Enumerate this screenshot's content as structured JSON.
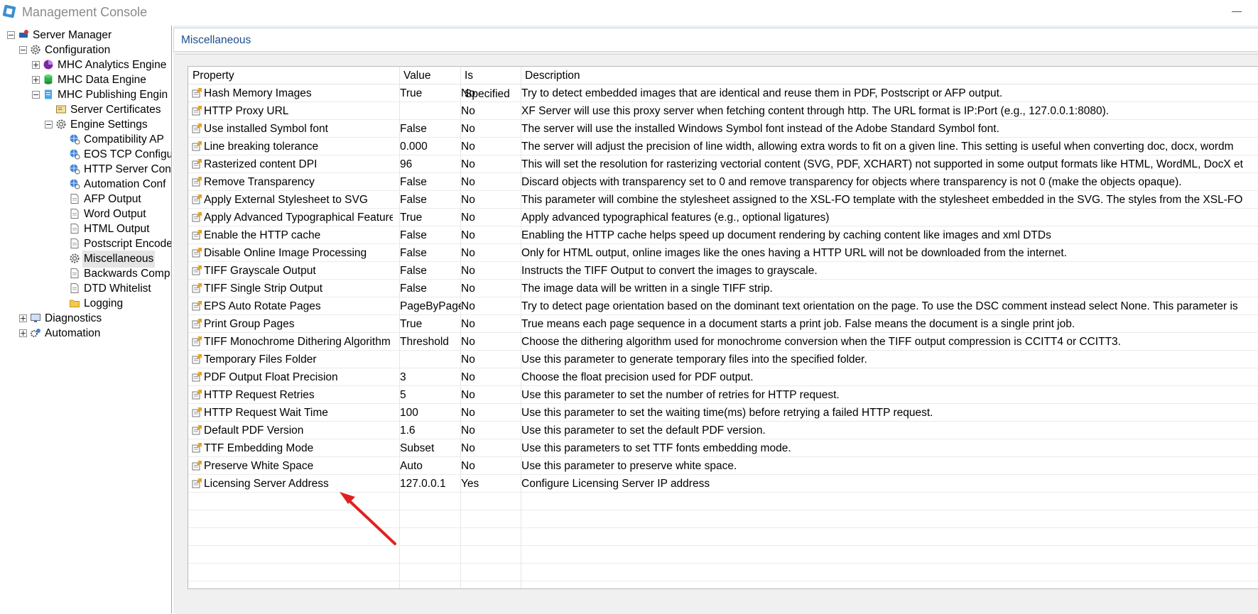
{
  "window": {
    "title": "Management Console",
    "icons": {
      "app": "app-logo-icon",
      "minimize": "minimize-icon"
    }
  },
  "tree": {
    "server_manager": "Server Manager",
    "configuration": "Configuration",
    "analytics_engine": "MHC Analytics Engine",
    "data_engine": "MHC Data Engine",
    "publishing_engine": "MHC Publishing Engin",
    "server_certificates": "Server Certificates",
    "engine_settings": "Engine Settings",
    "compatibility": "Compatibility AP",
    "eos_tcp": "EOS TCP Configu",
    "http_server": "HTTP Server Con",
    "automation_conf": "Automation Conf",
    "afp_output": "AFP Output",
    "word_output": "Word Output",
    "html_output": "HTML Output",
    "postscript": "Postscript Encode",
    "miscellaneous": "Miscellaneous",
    "backwards": "Backwards Comp",
    "dtd_whitelist": "DTD Whitelist",
    "logging": "Logging",
    "diagnostics": "Diagnostics",
    "automation": "Automation"
  },
  "section": {
    "title": "Miscellaneous"
  },
  "grid": {
    "columns": [
      "Property",
      "Value",
      "Is Specified",
      "Description"
    ],
    "rows": [
      {
        "property": "Hash Memory Images",
        "value": "True",
        "specified": "No",
        "description": "Try to detect embedded images that are identical and reuse them in PDF, Postscript or AFP output."
      },
      {
        "property": "HTTP Proxy URL",
        "value": "",
        "specified": "No",
        "description": "XF Server will use this proxy server when fetching content through http.  The URL format is IP:Port (e.g., 127.0.0.1:8080)."
      },
      {
        "property": "Use installed Symbol font",
        "value": "False",
        "specified": "No",
        "description": "The server will use the installed Windows Symbol font instead of the Adobe Standard Symbol font."
      },
      {
        "property": "Line breaking tolerance",
        "value": "0.000",
        "specified": "No",
        "description": "The server will adjust the precision of line width, allowing extra words to fit on a given line. This setting is useful when converting doc, docx, wordm"
      },
      {
        "property": "Rasterized content DPI",
        "value": "96",
        "specified": "No",
        "description": "This will set the resolution for rasterizing vectorial content (SVG, PDF, XCHART) not supported in some output formats like HTML, WordML, DocX et"
      },
      {
        "property": "Remove Transparency",
        "value": "False",
        "specified": "No",
        "description": "Discard objects with transparency set to 0 and remove transparency for objects where transparency is not 0 (make the objects opaque)."
      },
      {
        "property": "Apply External Stylesheet to SVG",
        "value": "False",
        "specified": "No",
        "description": "This parameter will combine the stylesheet assigned to the XSL-FO template with the stylesheet embedded in the SVG. The styles from the XSL-FO"
      },
      {
        "property": "Apply Advanced Typographical Features",
        "value": "True",
        "specified": "No",
        "description": "Apply advanced typographical features (e.g., optional ligatures)"
      },
      {
        "property": "Enable the HTTP cache",
        "value": "False",
        "specified": "No",
        "description": "Enabling the HTTP cache helps speed up document rendering by caching content like images and xml DTDs"
      },
      {
        "property": "Disable Online Image Processing",
        "value": "False",
        "specified": "No",
        "description": "Only for HTML output, online images like the ones having a HTTP URL will not be downloaded from the internet."
      },
      {
        "property": "TIFF Grayscale Output",
        "value": "False",
        "specified": "No",
        "description": "Instructs the TIFF Output to convert the images to grayscale."
      },
      {
        "property": "TIFF Single Strip Output",
        "value": "False",
        "specified": "No",
        "description": "The image data will be written in a single TIFF strip."
      },
      {
        "property": "EPS Auto Rotate Pages",
        "value": "PageByPage",
        "specified": "No",
        "description": "Try to detect page orientation based on the dominant text orientation on the page. To use the DSC comment instead select None. This parameter is"
      },
      {
        "property": "Print Group Pages",
        "value": "True",
        "specified": "No",
        "description": "True means each page sequence in a document starts a print job. False means the document is a single print job."
      },
      {
        "property": "TIFF Monochrome Dithering Algorithm",
        "value": "Threshold",
        "specified": "No",
        "description": "Choose the dithering algorithm used for monochrome conversion when the TIFF output compression is CCITT4 or CCITT3."
      },
      {
        "property": "Temporary Files Folder",
        "value": "",
        "specified": "No",
        "description": "Use this parameter to generate temporary files into the specified folder."
      },
      {
        "property": "PDF Output Float Precision",
        "value": "3",
        "specified": "No",
        "description": "Choose the float precision used for PDF output."
      },
      {
        "property": "HTTP Request Retries",
        "value": "5",
        "specified": "No",
        "description": "Use this parameter to set the number of retries for HTTP request."
      },
      {
        "property": "HTTP Request Wait Time",
        "value": "100",
        "specified": "No",
        "description": "Use this parameter to set the waiting time(ms) before retrying a failed HTTP request."
      },
      {
        "property": "Default PDF Version",
        "value": "1.6",
        "specified": "No",
        "description": "Use this parameter to set the default PDF version."
      },
      {
        "property": "TTF Embedding Mode",
        "value": "Subset",
        "specified": "No",
        "description": "Use this parameters to set TTF fonts embedding mode."
      },
      {
        "property": "Preserve White Space",
        "value": "Auto",
        "specified": "No",
        "description": "Use this parameter to preserve white space."
      },
      {
        "property": "Licensing Server Address",
        "value": "127.0.0.1",
        "specified": "Yes",
        "description": "Configure Licensing Server IP address"
      }
    ]
  },
  "colors": {
    "section_title": "#1d4e8c",
    "annotation_arrow": "#e02020"
  }
}
